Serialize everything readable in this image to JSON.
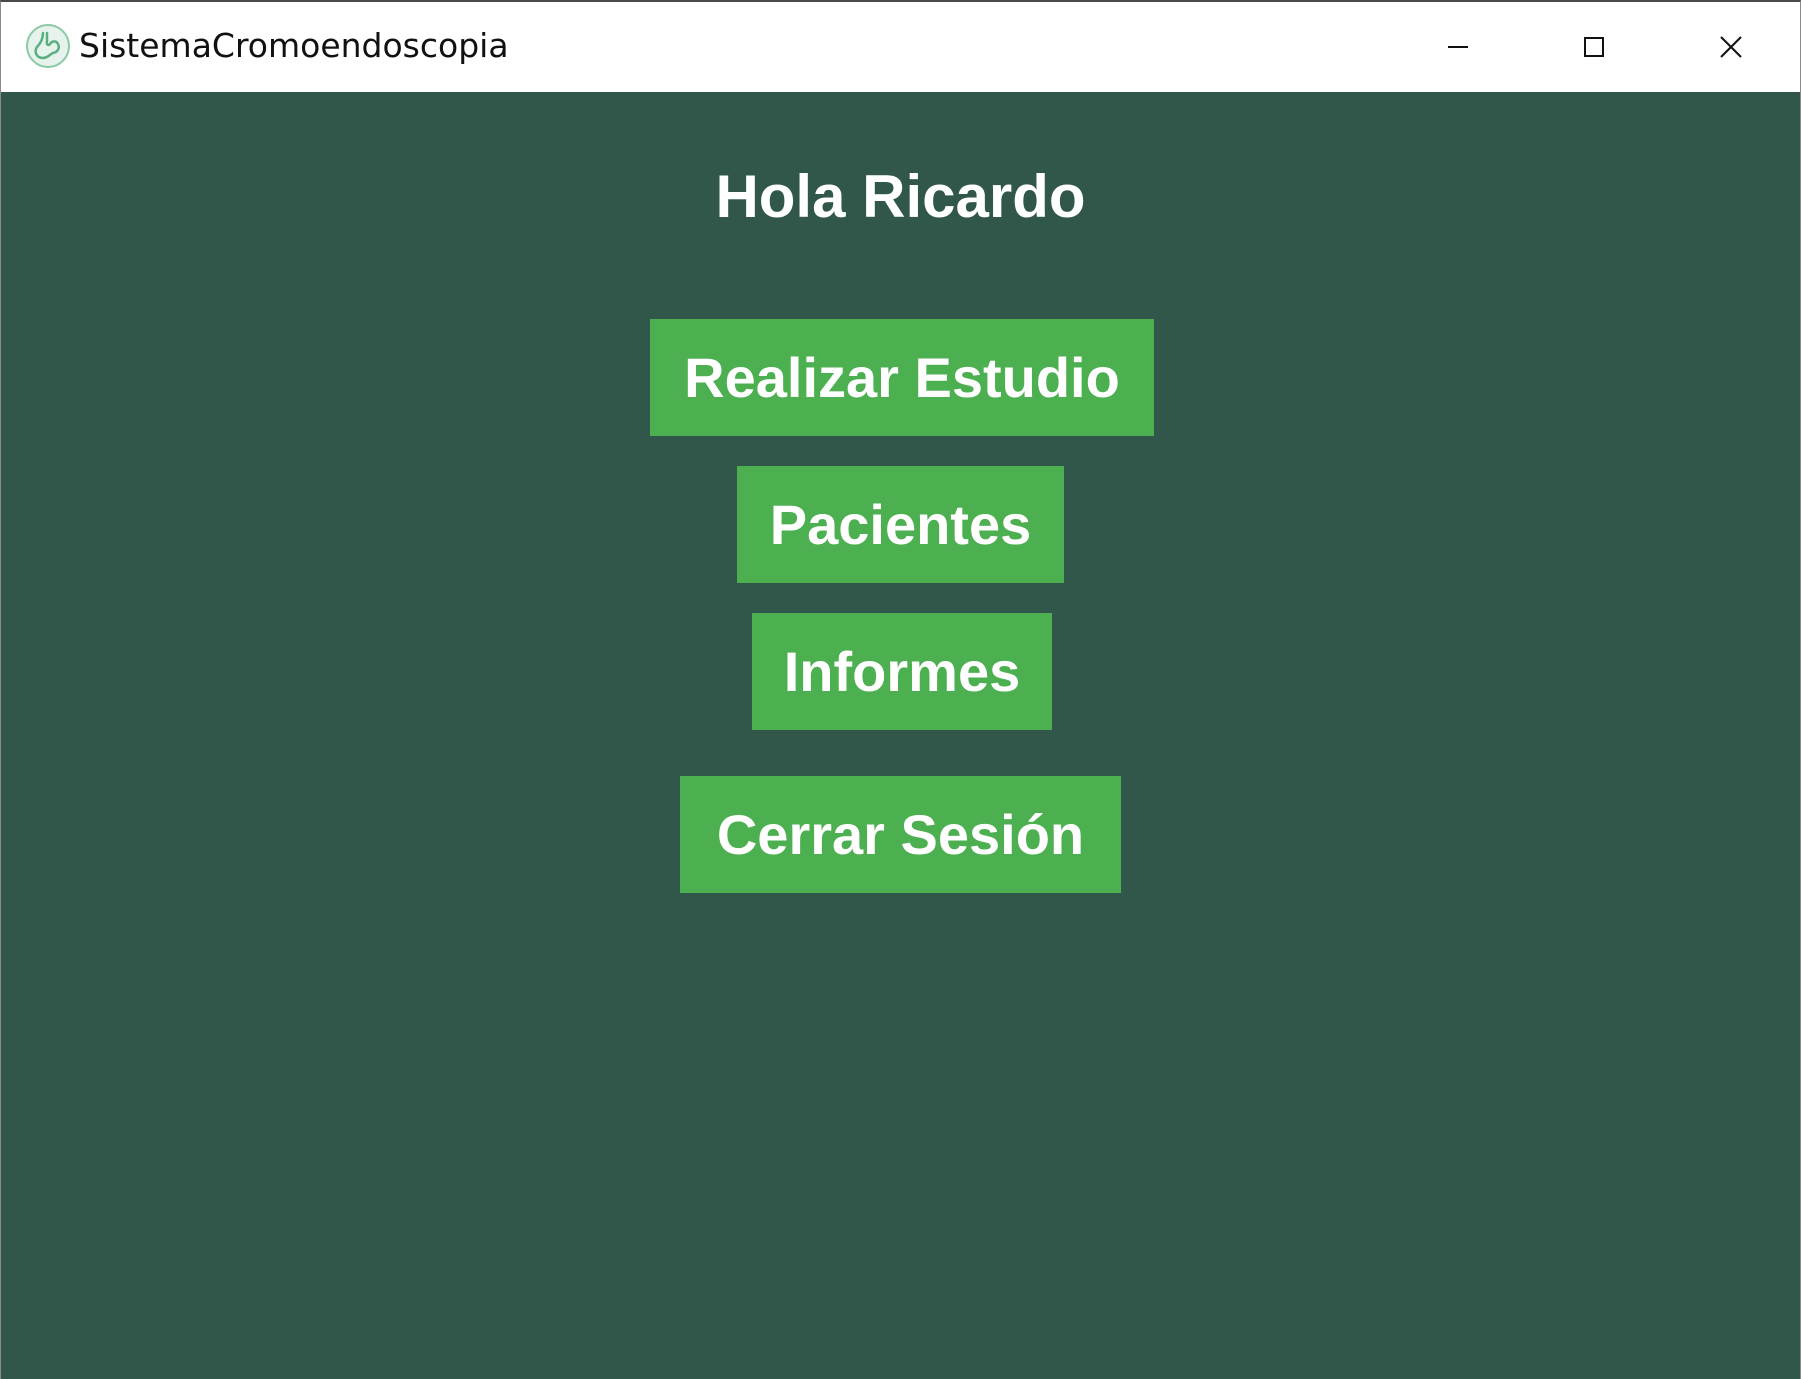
{
  "window": {
    "title": "SistemaCromoendoscopia",
    "icon": "stomach-icon",
    "controls": {
      "minimize_icon": "minimize-icon",
      "maximize_icon": "maximize-icon",
      "close_icon": "close-icon"
    }
  },
  "main": {
    "greeting": "Hola Ricardo",
    "buttons": [
      {
        "label": "Realizar Estudio"
      },
      {
        "label": "Pacientes"
      },
      {
        "label": "Informes"
      },
      {
        "label": "Cerrar Sesión"
      }
    ]
  },
  "colors": {
    "background": "#31564a",
    "button": "#4caf50",
    "text": "#ffffff"
  }
}
